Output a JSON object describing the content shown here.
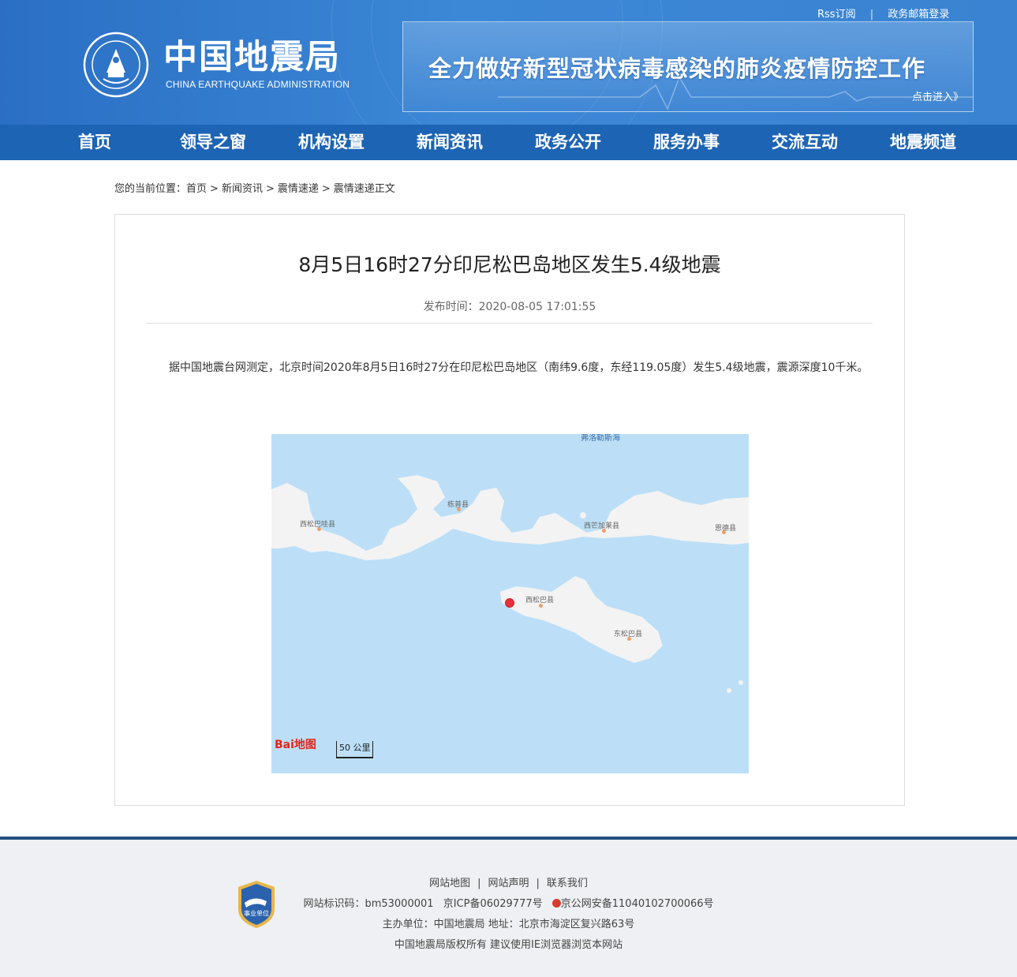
{
  "header": {
    "top_links": [
      "Rss订阅",
      "政务邮箱登录"
    ],
    "title": "中国地震局",
    "subtitle": "CHINA EARTHQUAKE ADMINISTRATION",
    "banner_text": "全力做好新型冠状病毒感染的肺炎疫情防控工作",
    "banner_enter": "点击进入》"
  },
  "nav": {
    "items": [
      "首页",
      "领导之窗",
      "机构设置",
      "新闻资讯",
      "政务公开",
      "服务办事",
      "交流互动",
      "地震频道"
    ]
  },
  "breadcrumb": {
    "prefix": "您的当前位置：",
    "items": [
      "首页",
      "新闻资讯",
      "震情速递",
      "震情速递正文"
    ]
  },
  "article": {
    "title": "8月5日16时27分印尼松巴岛地区发生5.4级地震",
    "publish_time": "发布时间：2020-08-05 17:01:55",
    "body": "据中国地震台网测定，北京时间2020年8月5日16时27分在印尼松巴岛地区（南纬9.6度，东经119.05度）发生5.4级地震，震源深度10千米。"
  },
  "map": {
    "labels": {
      "sea": "弗洛勒斯海",
      "west_sumbawa": "西松巴哇县",
      "bima": "栋普县",
      "west_manggarai": "西芒加莱县",
      "ende": "恩德县",
      "west_sumba": "西松巴县",
      "east_sumba": "东松巴县"
    },
    "logo": "Bai地图",
    "scale": "50 公里",
    "colors": {
      "water": "#bcdff7",
      "land": "#f3f3f3",
      "epicenter": "#e8313a"
    }
  },
  "footer": {
    "links": [
      "网站地图",
      "网站声明",
      "联系我们"
    ],
    "line2": [
      "网站标识码：bm53000001",
      "京ICP备06029777号",
      "京公网安备11040102700066号"
    ],
    "line3": "主办单位：中国地震局  地址：北京市海淀区复兴路63号",
    "line4": "中国地震局版权所有  建议使用IE浏览器浏览本网站",
    "badge": "事业单位"
  }
}
